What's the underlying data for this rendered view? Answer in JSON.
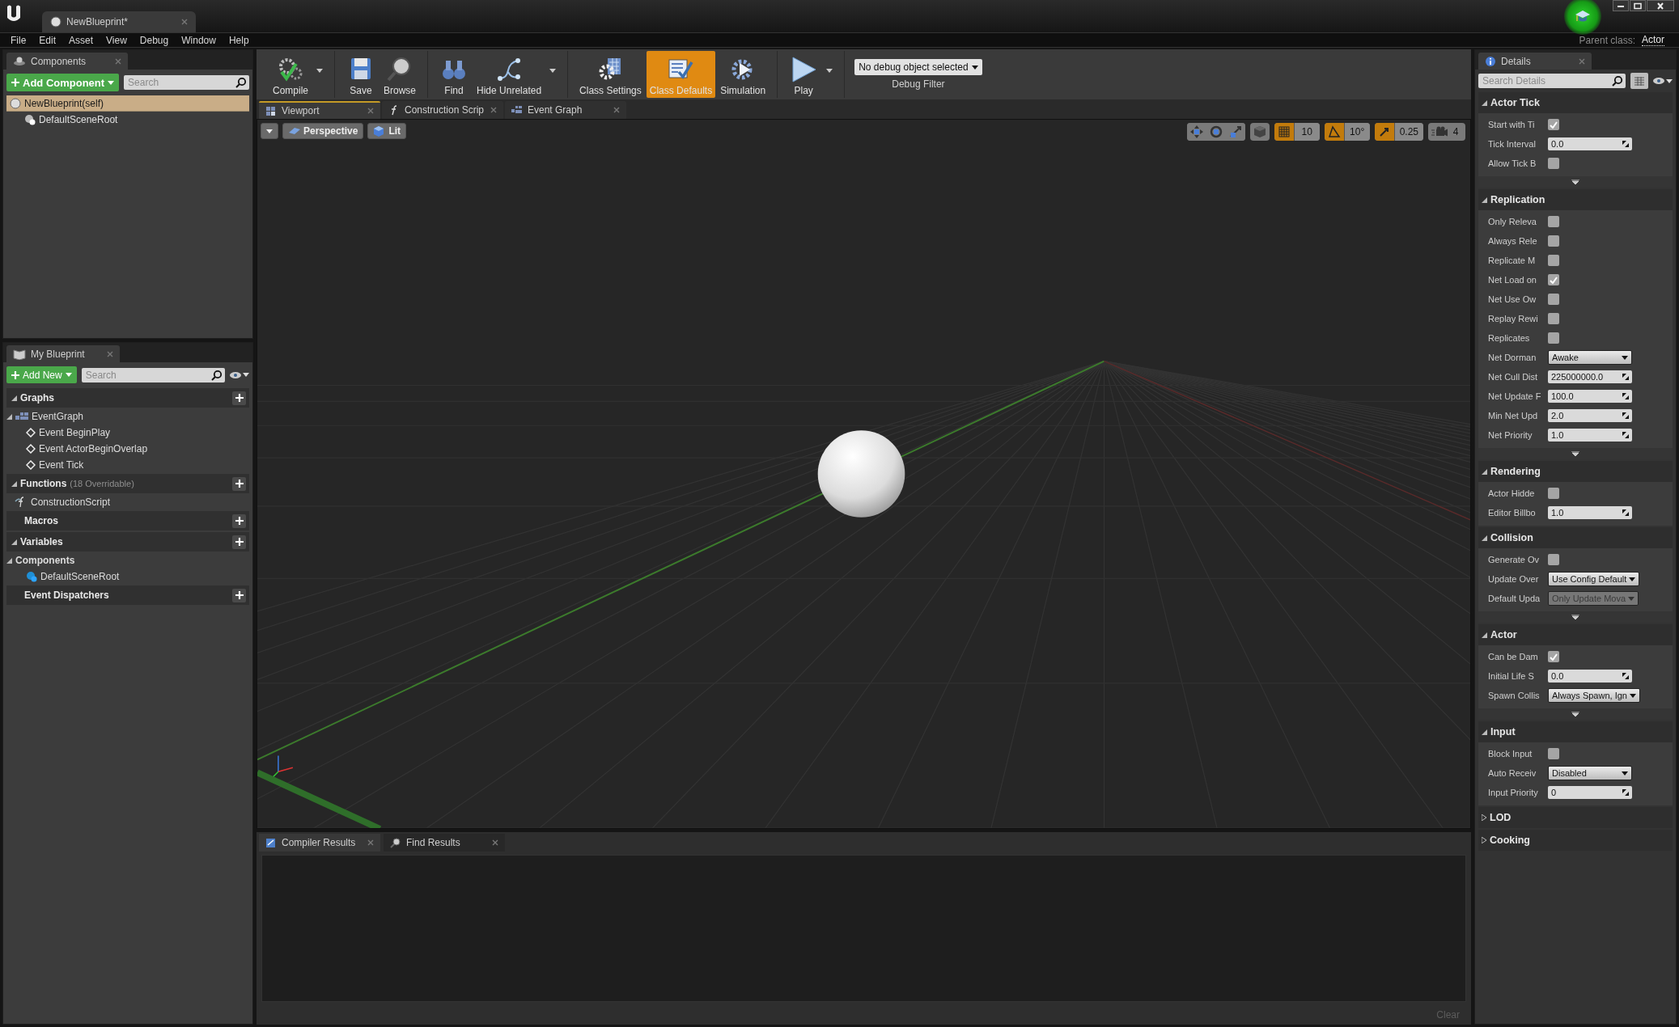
{
  "window": {
    "tab_title": "NewBlueprint*",
    "parent_class_label": "Parent class:",
    "parent_class": "Actor"
  },
  "menu": [
    "File",
    "Edit",
    "Asset",
    "View",
    "Debug",
    "Window",
    "Help"
  ],
  "components_panel": {
    "tab": "Components",
    "add_button": "Add Component",
    "search_placeholder": "Search",
    "tree": [
      {
        "label": "NewBlueprint(self)",
        "selected": true,
        "children": [
          {
            "label": "DefaultSceneRoot",
            "selected": false
          }
        ]
      }
    ]
  },
  "toolbar": {
    "groups": [
      [
        {
          "kind": "compile",
          "label": "Compile",
          "selected": false,
          "has_menu": true
        }
      ],
      [
        {
          "kind": "save",
          "label": "Save",
          "selected": false,
          "has_menu": false
        },
        {
          "kind": "browse",
          "label": "Browse",
          "selected": false,
          "has_menu": false
        }
      ],
      [
        {
          "kind": "find",
          "label": "Find",
          "selected": false,
          "has_menu": false
        },
        {
          "kind": "hide_unrelated",
          "label": "Hide Unrelated",
          "selected": false,
          "has_menu": true
        }
      ],
      [
        {
          "kind": "class_settings",
          "label": "Class Settings",
          "selected": false,
          "has_menu": false
        },
        {
          "kind": "class_defaults",
          "label": "Class Defaults",
          "selected": true,
          "has_menu": false
        },
        {
          "kind": "simulation",
          "label": "Simulation",
          "selected": false,
          "has_menu": false
        }
      ],
      [
        {
          "kind": "play",
          "label": "Play",
          "selected": false,
          "has_menu": true
        }
      ]
    ],
    "debug_filter": {
      "value": "No debug object selected",
      "label": "Debug Filter"
    }
  },
  "editor_tabs": [
    {
      "kind": "viewport",
      "label": "Viewport",
      "selected": true
    },
    {
      "kind": "function",
      "label": "Construction Scrip",
      "selected": false
    },
    {
      "kind": "graph",
      "label": "Event Graph",
      "selected": false
    }
  ],
  "viewport": {
    "view_buttons": [
      {
        "kind": "projection",
        "label": "Perspective"
      },
      {
        "kind": "lighting",
        "label": "Lit"
      }
    ],
    "snaps": [
      {
        "kind": "grid",
        "on": true,
        "value": "10"
      },
      {
        "kind": "rotation",
        "on": true,
        "value": "10°"
      },
      {
        "kind": "scale",
        "on": true,
        "value": "0.25"
      }
    ],
    "camera_speed": "4"
  },
  "my_blueprint": {
    "tab": "My Blueprint",
    "add_button": "Add New",
    "search_placeholder": "Search",
    "sections": [
      {
        "label": "Graphs",
        "expanded": true,
        "items": [
          {
            "kind": "graph",
            "label": "EventGraph",
            "expanded": true,
            "children": [
              {
                "kind": "event",
                "label": "Event BeginPlay"
              },
              {
                "kind": "event",
                "label": "Event ActorBeginOverlap"
              },
              {
                "kind": "event",
                "label": "Event Tick"
              }
            ]
          }
        ]
      },
      {
        "label": "Functions",
        "note": "(18 Overridable)",
        "expanded": true,
        "items": [
          {
            "kind": "function",
            "label": "ConstructionScript"
          }
        ]
      },
      {
        "label": "Macros"
      },
      {
        "label": "Variables",
        "expanded": true,
        "items": [
          {
            "kind": "category",
            "label": "Components",
            "expanded": true,
            "children": [
              {
                "kind": "component",
                "label": "DefaultSceneRoot"
              }
            ]
          }
        ]
      },
      {
        "label": "Event Dispatchers"
      }
    ]
  },
  "details": {
    "tab": "Details",
    "search_placeholder": "Search Details",
    "categories": [
      {
        "label": "Actor Tick",
        "expanded": true,
        "advanced": true,
        "rows": [
          {
            "kind": "checkbox",
            "label": "Start with Ti",
            "checked": true
          },
          {
            "kind": "number",
            "label": "Tick Interval",
            "value": "0.0"
          },
          {
            "kind": "checkbox",
            "label": "Allow Tick B",
            "checked": false
          }
        ]
      },
      {
        "label": "Replication",
        "expanded": true,
        "advanced": true,
        "rows": [
          {
            "kind": "checkbox",
            "label": "Only Releva",
            "checked": false
          },
          {
            "kind": "checkbox",
            "label": "Always Rele",
            "checked": false
          },
          {
            "kind": "checkbox",
            "label": "Replicate M",
            "checked": false
          },
          {
            "kind": "checkbox",
            "label": "Net Load on",
            "checked": true
          },
          {
            "kind": "checkbox",
            "label": "Net Use Ow",
            "checked": false
          },
          {
            "kind": "checkbox",
            "label": "Replay Rewi",
            "checked": false
          },
          {
            "kind": "checkbox",
            "label": "Replicates",
            "checked": false
          },
          {
            "kind": "dropdown",
            "label": "Net Dorman",
            "value": "Awake",
            "disabled": false
          },
          {
            "kind": "number",
            "label": "Net Cull Dist",
            "value": "225000000.0"
          },
          {
            "kind": "number",
            "label": "Net Update F",
            "value": "100.0"
          },
          {
            "kind": "number",
            "label": "Min Net Upd",
            "value": "2.0"
          },
          {
            "kind": "number",
            "label": "Net Priority",
            "value": "1.0"
          }
        ]
      },
      {
        "label": "Rendering",
        "expanded": true,
        "advanced": false,
        "rows": [
          {
            "kind": "checkbox",
            "label": "Actor Hidde",
            "checked": false
          },
          {
            "kind": "number",
            "label": "Editor Billbo",
            "value": "1.0"
          }
        ]
      },
      {
        "label": "Collision",
        "expanded": true,
        "advanced": true,
        "rows": [
          {
            "kind": "checkbox",
            "label": "Generate Ov",
            "checked": false
          },
          {
            "kind": "dropdown",
            "label": "Update Over",
            "value": "Use Config Default",
            "disabled": false
          },
          {
            "kind": "dropdown",
            "label": "Default Upda",
            "value": "Only Update Mova",
            "disabled": true
          }
        ]
      },
      {
        "label": "Actor",
        "expanded": true,
        "advanced": true,
        "rows": [
          {
            "kind": "checkbox",
            "label": "Can be Dam",
            "checked": true
          },
          {
            "kind": "number",
            "label": "Initial Life S",
            "value": "0.0"
          },
          {
            "kind": "dropdown",
            "label": "Spawn Collis",
            "value": "Always Spawn, Ign",
            "disabled": false
          }
        ]
      },
      {
        "label": "Input",
        "expanded": true,
        "advanced": false,
        "rows": [
          {
            "kind": "checkbox",
            "label": "Block Input",
            "checked": false
          },
          {
            "kind": "dropdown",
            "label": "Auto Receiv",
            "value": "Disabled",
            "disabled": false
          },
          {
            "kind": "number",
            "label": "Input Priority",
            "value": "0"
          }
        ]
      },
      {
        "label": "LOD",
        "expanded": false,
        "advanced": false
      },
      {
        "label": "Cooking",
        "expanded": false,
        "advanced": false
      }
    ]
  },
  "bottom_panel": {
    "tabs": [
      {
        "kind": "compiler",
        "label": "Compiler Results",
        "selected": true
      },
      {
        "kind": "find",
        "label": "Find Results",
        "selected": false
      }
    ],
    "clear_button": {
      "label": "Clear",
      "disabled": true
    }
  }
}
